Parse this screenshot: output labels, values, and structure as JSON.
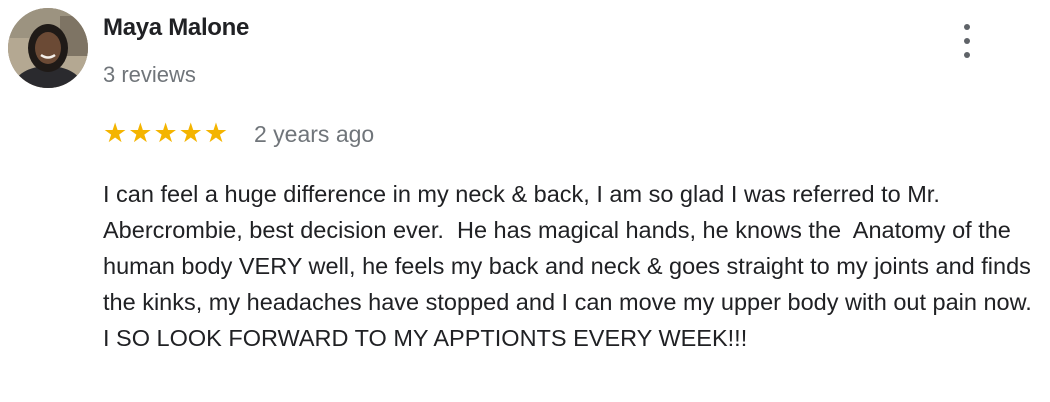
{
  "reviewer": {
    "name": "Maya Malone",
    "reviews_count": "3 reviews"
  },
  "rating": {
    "stars": 5,
    "max": 5,
    "star_glyph": "★",
    "color": "#f4b400"
  },
  "age": "2 years ago",
  "review_text": "I can feel a huge difference in my neck & back, I am so glad I was referred to Mr. Abercrombie, best decision ever.  He has magical hands, he knows the  Anatomy of the human body VERY well, he feels my back and neck & goes straight to my joints and finds the kinks, my headaches have stopped and I can move my upper body with out pain now. I SO LOOK FORWARD TO MY APPTIONTS EVERY WEEK!!!",
  "icons": {
    "menu": "more-vert-icon",
    "star": "star-icon"
  }
}
